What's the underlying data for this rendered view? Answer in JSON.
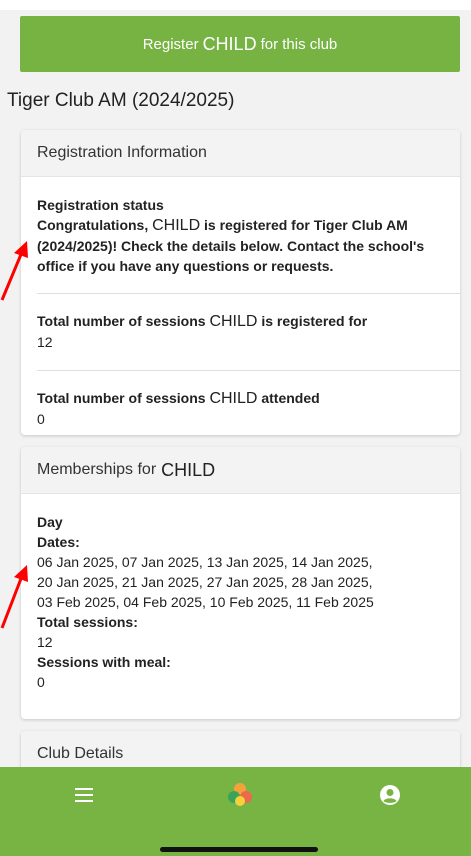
{
  "register_button": {
    "prefix": "Register",
    "child": "CHILD",
    "suffix": "for this club"
  },
  "club_title": "Tiger Club AM (2024/2025)",
  "registration_card": {
    "header": "Registration Information",
    "status_label": "Registration status",
    "status_prefix": "Congratulations,",
    "child": "CHILD",
    "status_text": "is registered for Tiger Club AM (2024/2025)! Check the details below. Contact the school's office if you have any questions or requests.",
    "sessions_registered_label_prefix": "Total number of sessions",
    "sessions_registered_label_suffix": "is registered for",
    "sessions_registered_value": "12",
    "sessions_attended_label_prefix": "Total number of sessions",
    "sessions_attended_label_suffix": "attended",
    "sessions_attended_value": "0"
  },
  "membership_card": {
    "header_prefix": "Memberships for",
    "child": "CHILD",
    "day_label": "Day",
    "dates_label": "Dates:",
    "dates_lines": [
      "06 Jan 2025, 07 Jan 2025, 13 Jan 2025, 14 Jan 2025,",
      "20 Jan 2025, 21 Jan 2025, 27 Jan 2025, 28 Jan 2025,",
      "03 Feb 2025, 04 Feb 2025, 10 Feb 2025, 11 Feb 2025"
    ],
    "total_sessions_label": "Total sessions:",
    "total_sessions_value": "12",
    "meal_sessions_label": "Sessions with meal:",
    "meal_sessions_value": "0"
  },
  "club_details_card": {
    "header": "Club Details"
  },
  "bottom_nav": {
    "items": [
      {
        "icon": "menu-icon"
      },
      {
        "icon": "app-logo-icon"
      },
      {
        "icon": "account-icon"
      }
    ]
  },
  "colors": {
    "accent": "#76b342",
    "annotation_arrow": "#ff0000"
  }
}
